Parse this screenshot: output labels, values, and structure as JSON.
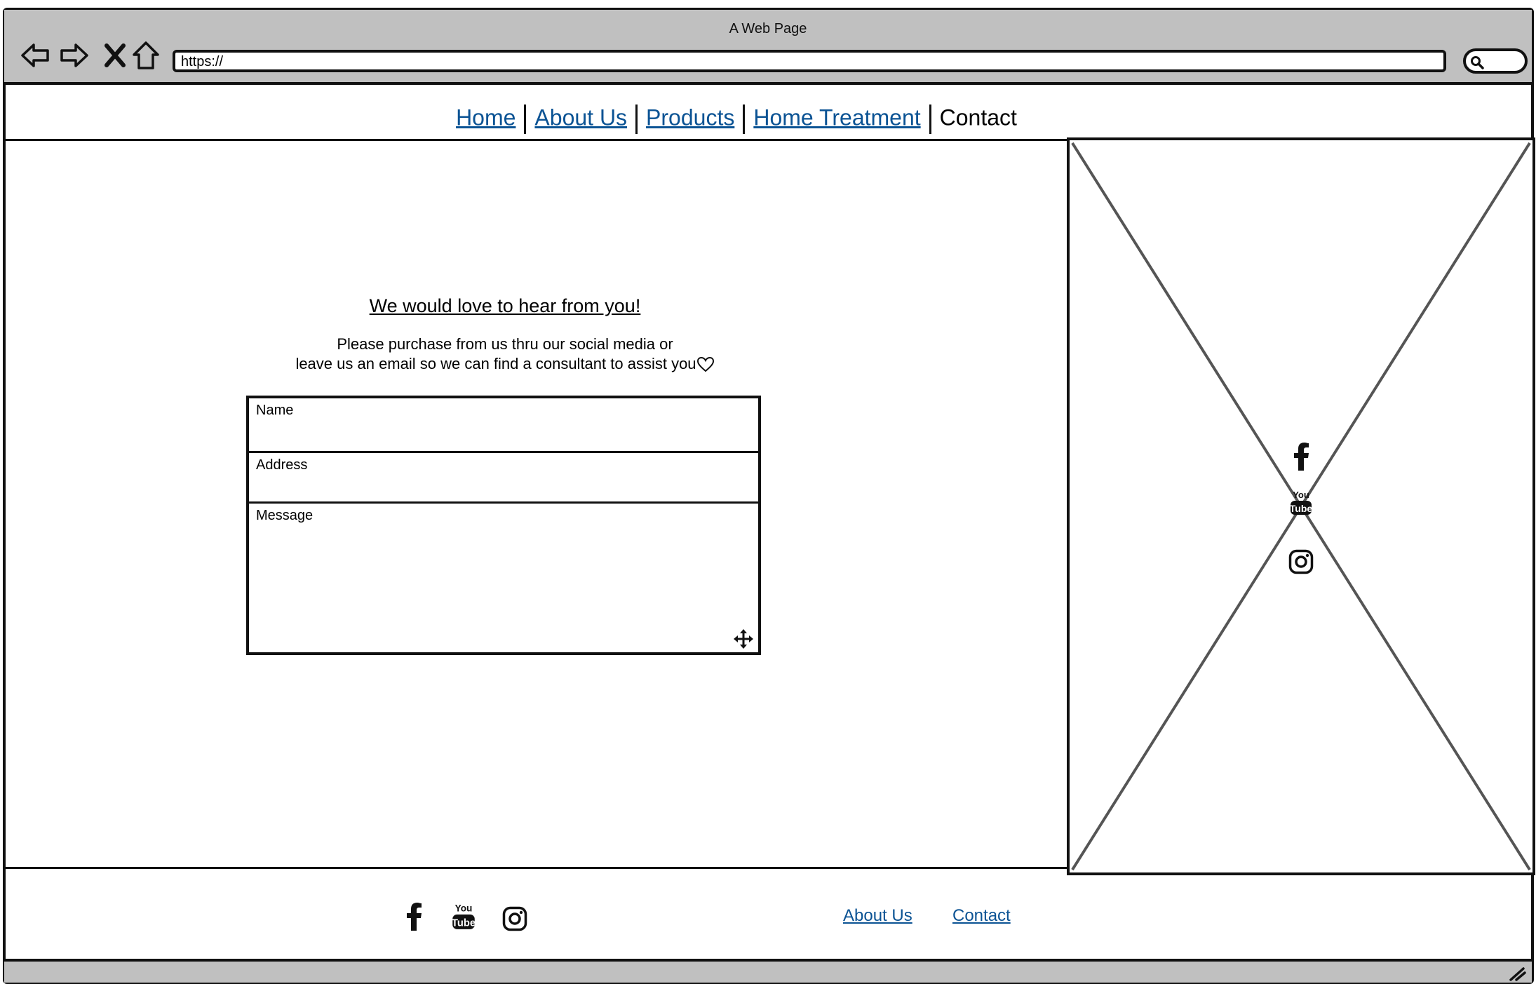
{
  "browser": {
    "window_title": "A Web Page",
    "url": "https://",
    "nav_icons": [
      "back-arrow-icon",
      "forward-arrow-icon",
      "close-x-icon",
      "home-icon"
    ],
    "search_icon": "search-icon"
  },
  "nav": {
    "items": [
      {
        "label": "Home"
      },
      {
        "label": "About Us"
      },
      {
        "label": "Products"
      },
      {
        "label": "Home Treatment"
      }
    ],
    "current": "Contact"
  },
  "main": {
    "heading": "We would love to hear from you!",
    "text_line1": "Please purchase from us thru our social media or",
    "text_line2": "leave us an email so we can find a consultant to assist you",
    "text_icon": "heart-icon"
  },
  "form": {
    "name_label": "Name",
    "address_label": "Address",
    "message_label": "Message"
  },
  "side_social": [
    "facebook-icon",
    "youtube-icon",
    "instagram-icon"
  ],
  "footer": {
    "social": [
      "facebook-icon",
      "youtube-icon",
      "instagram-icon"
    ],
    "links": [
      {
        "label": "About Us"
      },
      {
        "label": "Contact"
      }
    ]
  },
  "colors": {
    "link": "#0b5394",
    "chrome": "#c0c0c0",
    "ink": "#111111"
  }
}
